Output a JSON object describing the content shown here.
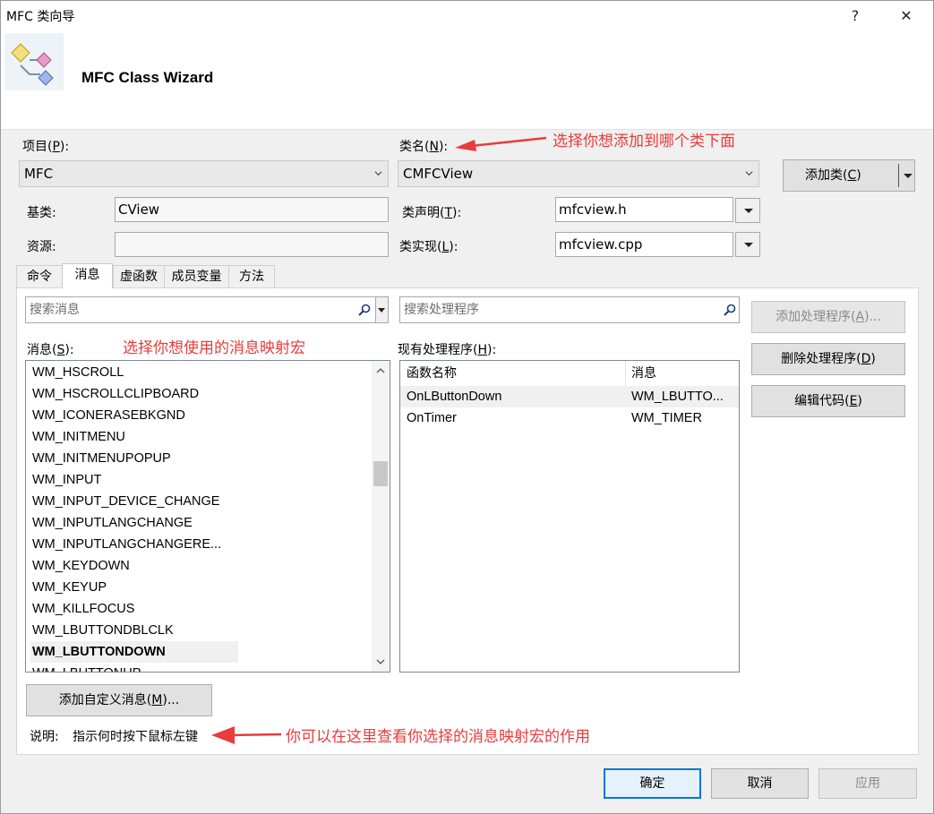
{
  "window": {
    "title": "MFC 类向导",
    "help_label": "?",
    "close_label": "✕",
    "header_title": "MFC Class Wizard"
  },
  "project": {
    "label_pre": "项目(",
    "label_key": "P",
    "label_post": "):",
    "value": "MFC"
  },
  "class_name": {
    "label_pre": "类名(",
    "label_key": "N",
    "label_post": "):",
    "value": "CMFCView"
  },
  "add_class": {
    "label_pre": "添加类(",
    "label_key": "C",
    "label_post": ")"
  },
  "base_class": {
    "label": "基类:",
    "value": "CView"
  },
  "resource": {
    "label": "资源:",
    "value": ""
  },
  "class_decl": {
    "label_pre": "类声明(",
    "label_key": "T",
    "label_post": "):",
    "value": "mfcview.h"
  },
  "class_impl": {
    "label_pre": "类实现(",
    "label_key": "L",
    "label_post": "):",
    "value": "mfcview.cpp"
  },
  "tabs": [
    "命令",
    "消息",
    "虚函数",
    "成员变量",
    "方法"
  ],
  "search_messages": {
    "placeholder": "搜索消息"
  },
  "search_handlers": {
    "placeholder": "搜索处理程序"
  },
  "messages": {
    "label_pre": "消息(",
    "label_key": "S",
    "label_post": "):",
    "items": [
      "WM_HSCROLL",
      "WM_HSCROLLCLIPBOARD",
      "WM_ICONERASEBKGND",
      "WM_INITMENU",
      "WM_INITMENUPOPUP",
      "WM_INPUT",
      "WM_INPUT_DEVICE_CHANGE",
      "WM_INPUTLANGCHANGE",
      "WM_INPUTLANGCHANGERE...",
      "WM_KEYDOWN",
      "WM_KEYUP",
      "WM_KILLFOCUS",
      "WM_LBUTTONDBLCLK",
      "WM_LBUTTONDOWN",
      "WM_LBUTTONUP"
    ],
    "selected_index": 13
  },
  "handlers": {
    "label_pre": "现有处理程序(",
    "label_key": "H",
    "label_post": "):",
    "columns": [
      "函数名称",
      "消息"
    ],
    "rows": [
      [
        "OnLButtonDown",
        "WM_LBUTTO..."
      ],
      [
        "OnTimer",
        "WM_TIMER"
      ]
    ]
  },
  "buttons": {
    "add_handler": {
      "label_pre": "添加处理程序(",
      "label_key": "A",
      "label_post": ")..."
    },
    "delete_handler": {
      "label_pre": "删除处理程序(",
      "label_key": "D",
      "label_post": ")"
    },
    "edit_code": {
      "label_pre": "编辑代码(",
      "label_key": "E",
      "label_post": ")"
    },
    "add_custom": {
      "label_pre": "添加自定义消息(",
      "label_key": "M",
      "label_post": ")..."
    },
    "ok": "确定",
    "cancel": "取消",
    "apply": "应用"
  },
  "description": {
    "label": "说明:",
    "text": "指示何时按下鼠标左键"
  },
  "annotations": {
    "class_hint": "选择你想添加到哪个类下面",
    "message_hint": "选择你想使用的消息映射宏",
    "desc_hint": "你可以在这里查看你选择的消息映射宏的作用"
  },
  "colors": {
    "annotation": "#e93b3b",
    "accent": "#0078d7"
  }
}
